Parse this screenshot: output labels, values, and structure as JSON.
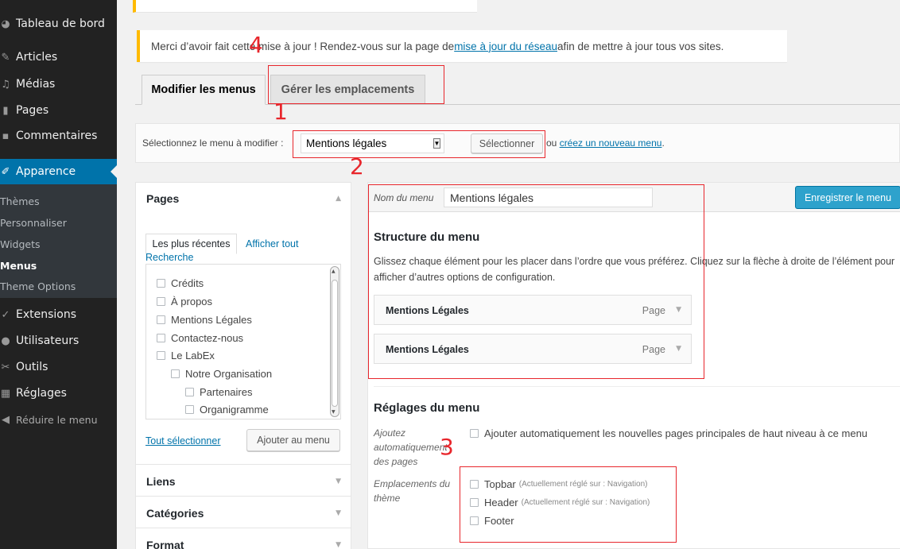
{
  "sidebar": {
    "dashboard": "Tableau de bord",
    "articles": "Articles",
    "medias": "Médias",
    "pages": "Pages",
    "comments": "Commentaires",
    "appearance": "Apparence",
    "sub_themes": "Thèmes",
    "sub_customize": "Personnaliser",
    "sub_widgets": "Widgets",
    "sub_menus": "Menus",
    "sub_theme_options": "Theme Options",
    "extensions": "Extensions",
    "users": "Utilisateurs",
    "tools": "Outils",
    "settings": "Réglages",
    "collapse": "Réduire le menu"
  },
  "notice": {
    "text_before": "Merci d’avoir fait cette mise à jour ! Rendez-vous sur la page de ",
    "link": "mise à jour du réseau",
    "text_after": " afin de mettre à jour tous vos sites."
  },
  "tabs": {
    "edit": "Modifier les menus",
    "locations": "Gérer les emplacements"
  },
  "select_bar": {
    "label": "Sélectionnez le menu à modifier :",
    "selected_menu": "Mentions légales",
    "select_button": "Sélectionner",
    "or_text": "ou ",
    "create_link": "créez un nouveau menu",
    "period": "."
  },
  "left": {
    "pages_title": "Pages",
    "tab_recent": "Les plus récentes",
    "tab_all": "Afficher tout",
    "tab_search": "Recherche",
    "pages_list": [
      "Crédits",
      "À propos",
      "Mentions Légales",
      "Contactez-nous",
      "Le LabEx",
      "Notre Organisation",
      "Partenaires",
      "Organigramme"
    ],
    "select_all": "Tout sélectionner",
    "add_button": "Ajouter au menu",
    "links_title": "Liens",
    "categories_title": "Catégories",
    "format_title": "Format"
  },
  "right": {
    "name_label": "Nom du menu",
    "name_value": "Mentions légales",
    "save_button": "Enregistrer le menu",
    "structure_title": "Structure du menu",
    "structure_desc": "Glissez chaque élément pour les placer dans l’ordre que vous préférez. Cliquez sur la flèche à droite de l’élément pour afficher d’autres options de configuration.",
    "items": [
      {
        "title": "Mentions Légales",
        "type": "Page"
      },
      {
        "title": "Mentions Légales",
        "type": "Page"
      }
    ],
    "settings_title": "Réglages du menu",
    "auto_add_label": "Ajoutez automatiquement des pages",
    "auto_add_text": "Ajouter automatiquement les nouvelles pages principales de haut niveau à ce menu",
    "locations_label": "Emplacements du thème",
    "locations": [
      {
        "name": "Topbar",
        "note": "(Actuellement réglé sur : Navigation)"
      },
      {
        "name": "Header",
        "note": "(Actuellement réglé sur : Navigation)"
      },
      {
        "name": "Footer",
        "note": ""
      }
    ]
  },
  "annotations": [
    "1",
    "2",
    "3",
    "4"
  ],
  "colors": {
    "sidebar_bg": "#222222",
    "active_blue": "#0073aa",
    "notice_border": "#ffba00",
    "save_button": "#2ea2cc",
    "annotation_red": "#e8262c"
  }
}
